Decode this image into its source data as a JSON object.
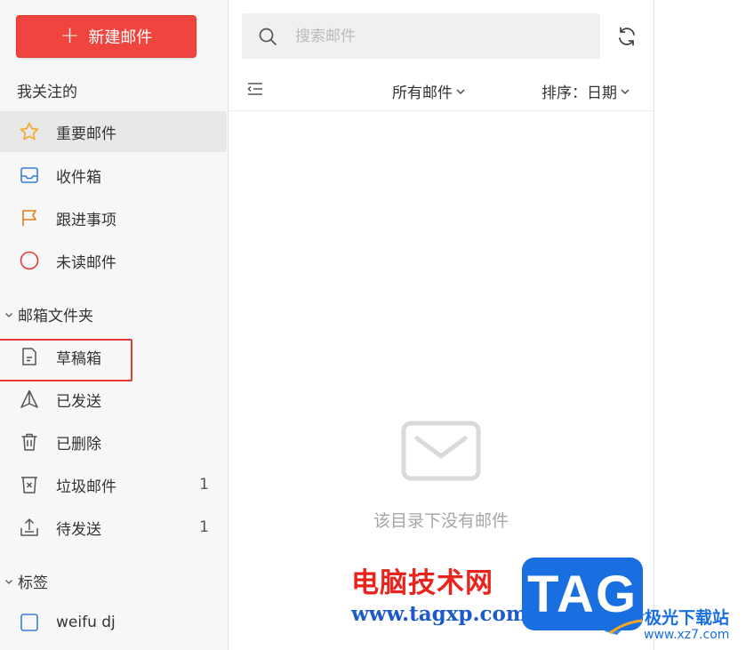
{
  "sidebar": {
    "compose_label": "新建邮件",
    "following_title": "我关注的",
    "following_items": [
      {
        "label": "重要邮件",
        "icon": "star-icon"
      },
      {
        "label": "收件箱",
        "icon": "inbox-icon"
      },
      {
        "label": "跟进事项",
        "icon": "flag-icon"
      },
      {
        "label": "未读邮件",
        "icon": "circle-icon"
      }
    ],
    "folders_title": "邮箱文件夹",
    "folder_items": [
      {
        "label": "草稿箱",
        "icon": "draft-icon",
        "count": ""
      },
      {
        "label": "已发送",
        "icon": "sent-icon",
        "count": ""
      },
      {
        "label": "已删除",
        "icon": "trash-icon",
        "count": ""
      },
      {
        "label": "垃圾邮件",
        "icon": "spam-icon",
        "count": "1"
      },
      {
        "label": "待发送",
        "icon": "outbox-icon",
        "count": "1"
      }
    ],
    "tags_title": "标签",
    "tag_items": [
      {
        "label": "weifu dj",
        "icon": "checkbox-icon"
      }
    ]
  },
  "main": {
    "search_placeholder": "搜索邮件",
    "filter_label": "所有邮件",
    "sort_label": "排序：日期",
    "empty_text": "该目录下没有邮件"
  },
  "watermark": {
    "site_name": "电脑技术网",
    "site_url": "www.tagxp.com",
    "tag_logo": "TAG",
    "site2_name": "极光下载站",
    "site2_url": "www.xz7.com"
  },
  "colors": {
    "accent": "#f0453e",
    "star": "#f5a623",
    "inbox": "#3a7bd5",
    "flag": "#e07b1a",
    "unread": "#e53935",
    "highlight": "#e53935"
  }
}
